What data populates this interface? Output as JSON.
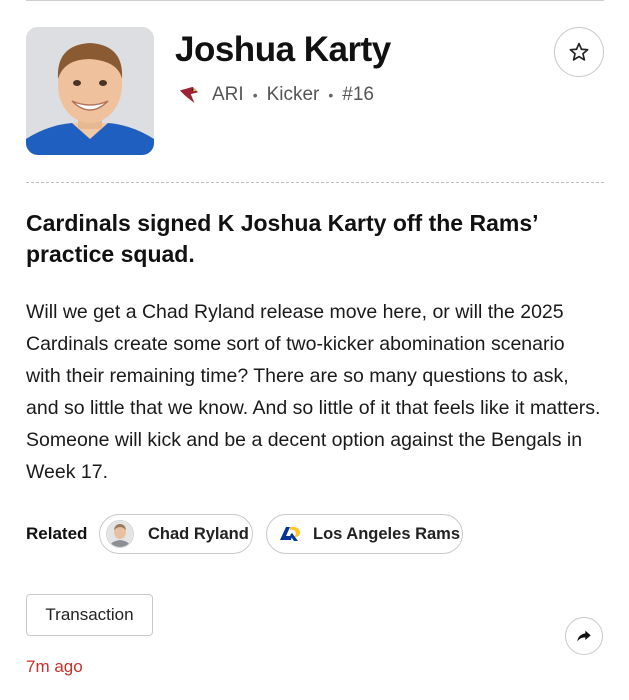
{
  "player": {
    "name": "Joshua Karty",
    "team": "ARI",
    "position": "Kicker",
    "number": "#16",
    "team_logo_icon": "cardinals-logo-icon",
    "photo_icon": "player-headshot"
  },
  "post": {
    "headline": "Cardinals signed K Joshua Karty off the Rams’ practice squad.",
    "body": "Will we get a Chad Ryland release move here, or will the 2025 Cardinals create some sort of two-kicker abomination scenario with their remaining time? There are so many questions to ask, and so little that we know. And so little of it that feels like it matters. Someone will kick and be a decent option against the Bengals in Week 17.",
    "timestamp": "7m ago"
  },
  "related": {
    "label": "Related",
    "chips": [
      {
        "label": "Chad Ryland",
        "icon": "player-avatar"
      },
      {
        "label": "Los Angeles Rams",
        "icon": "rams-logo-icon"
      }
    ]
  },
  "tag": {
    "label": "Transaction"
  },
  "icons": {
    "favorite": "star-icon",
    "share": "share-arrow-icon"
  },
  "colors": {
    "timestamp": "#c7312b",
    "cardinals_red": "#9b2335",
    "rams_blue": "#003594",
    "rams_gold": "#ffc72c"
  }
}
